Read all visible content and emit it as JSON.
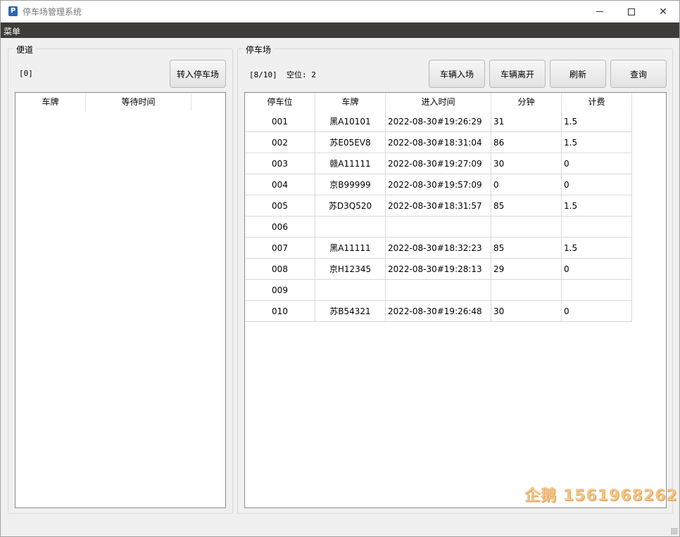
{
  "window": {
    "icon_letter": "P",
    "title": "停车场管理系统"
  },
  "menubar": {
    "menu_label": "菜单"
  },
  "sidebar": {
    "group_title": "便道",
    "count_text": "[0]",
    "transfer_button": "转入停车场",
    "columns": [
      "车牌",
      "等待时间"
    ]
  },
  "parking": {
    "group_title": "停车场",
    "status_text": "[8/10]  空位: 2",
    "buttons": {
      "enter": "车辆入场",
      "leave": "车辆离开",
      "refresh": "刷新",
      "query": "查询"
    },
    "columns": [
      "停车位",
      "车牌",
      "进入时间",
      "分钟",
      "计费"
    ],
    "rows": [
      [
        "001",
        "黑A10101",
        "2022-08-30#19:26:29",
        "31",
        "1.5"
      ],
      [
        "002",
        "苏E05EV8",
        "2022-08-30#18:31:04",
        "86",
        "1.5"
      ],
      [
        "003",
        "赣A11111",
        "2022-08-30#19:27:09",
        "30",
        "0"
      ],
      [
        "004",
        "京B99999",
        "2022-08-30#19:57:09",
        "0",
        "0"
      ],
      [
        "005",
        "苏D3Q520",
        "2022-08-30#18:31:57",
        "85",
        "1.5"
      ],
      [
        "006",
        "",
        "",
        "",
        ""
      ],
      [
        "007",
        "黑A11111",
        "2022-08-30#18:32:23",
        "85",
        "1.5"
      ],
      [
        "008",
        "京H12345",
        "2022-08-30#19:28:13",
        "29",
        "0"
      ],
      [
        "009",
        "",
        "",
        "",
        ""
      ],
      [
        "010",
        "苏B54321",
        "2022-08-30#19:26:48",
        "30",
        "0"
      ]
    ]
  },
  "watermark": "企鹅 1561968262",
  "colors": {
    "menubar_bg": "#3f3b36",
    "app_icon": "#2f63b8",
    "watermark": "#f2c58a"
  }
}
